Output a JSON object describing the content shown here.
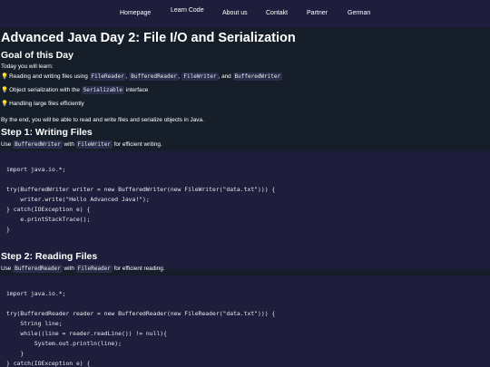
{
  "nav": {
    "items": [
      "Homepage",
      "Learn Code",
      "About us",
      "Contakt",
      "Partner",
      "German"
    ]
  },
  "page": {
    "title": "Advanced Java Day 2: File I/O and Serialization"
  },
  "goal": {
    "heading": "Goal of this Day",
    "intro": "Today you will learn:",
    "bullet1": {
      "a": "Reading and writing files using",
      "c1": "FileReader",
      "s1": ",",
      "c2": "BufferedReader",
      "s2": ",",
      "c3": "FileWriter",
      "s3": ", and",
      "c4": "BufferedWriter"
    },
    "bullet2": {
      "a": "Object serialization with the",
      "c1": "Serializable",
      "b": "interface"
    },
    "bullet3": "Handling large files efficiently",
    "outro": "By the end, you will be able to read and write files and serialize objects in Java."
  },
  "step1": {
    "heading": "Step 1: Writing Files",
    "desc": {
      "a": "Use",
      "c1": "BufferedWriter",
      "b": "with",
      "c2": "FileWriter",
      "c": "for efficient writing."
    },
    "code": [
      "import java.io.*;",
      "",
      "try(BufferedWriter writer = new BufferedWriter(new FileWriter(\"data.txt\"))) {",
      "    writer.write(\"Hello Advanced Java!\");",
      "} catch(IOException e) {",
      "    e.printStackTrace();",
      "}"
    ]
  },
  "step2": {
    "heading": "Step 2: Reading Files",
    "desc": {
      "a": "Use",
      "c1": "BufferedReader",
      "b": "with",
      "c2": "FileReader",
      "c": "for efficient reading."
    },
    "code": [
      "import java.io.*;",
      "",
      "try(BufferedReader reader = new BufferedReader(new FileReader(\"data.txt\"))) {",
      "    String line;",
      "    while((line = reader.readLine()) != null){",
      "        System.out.println(line);",
      "    }",
      "} catch(IOException e) {"
    ]
  },
  "icons": {
    "bullet": "lightbulb-icon"
  }
}
